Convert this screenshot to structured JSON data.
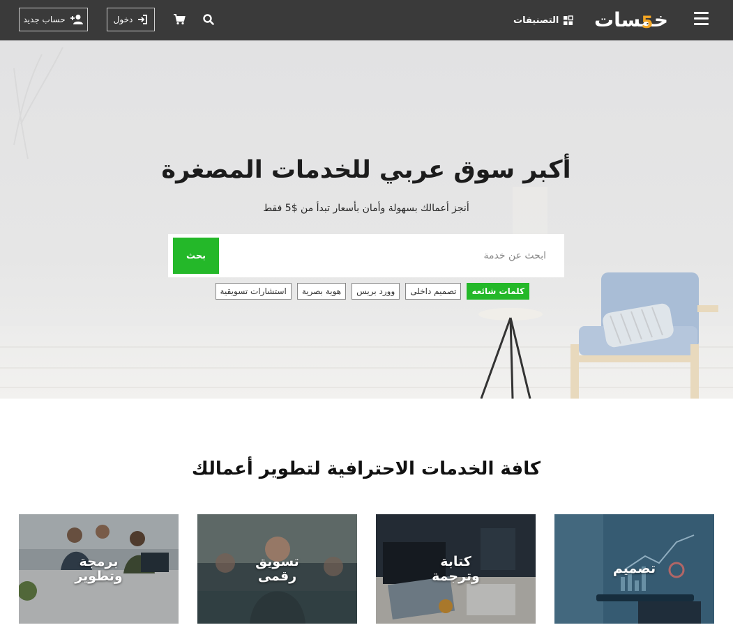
{
  "header": {
    "logo_text": "خمسات",
    "categories_label": "التصنيفات",
    "login_label": "دخول",
    "signup_label": "حساب جديد",
    "icons": [
      "menu-icon",
      "categories-icon",
      "search-icon",
      "cart-icon",
      "login-icon",
      "add-user-icon"
    ]
  },
  "hero": {
    "title": "أكبر سوق عربي للخدمات المصغرة",
    "subtitle": "أنجز أعمالك بسهولة وأمان بأسعار تبدأ من $5 فقط",
    "search": {
      "placeholder": "ابحث عن خدمة",
      "button_label": "بحث"
    },
    "popular_label": "كلمات شائعه",
    "tags": [
      "تصميم داخلى",
      "وورد بريس",
      "هوية بصرية",
      "استشارات تسويقية"
    ]
  },
  "services": {
    "title": "كافة الخدمات الاحترافية لتطوير أعمالك",
    "cards": [
      {
        "label": "تصميم"
      },
      {
        "label": "كتابة وترجمة"
      },
      {
        "label": "تسويق رقمى"
      },
      {
        "label": "برمجة وتطوير"
      }
    ]
  },
  "colors": {
    "topbar": "#3a3a3a",
    "accent_green": "#24b829",
    "logo_accent": "#f5a623"
  }
}
